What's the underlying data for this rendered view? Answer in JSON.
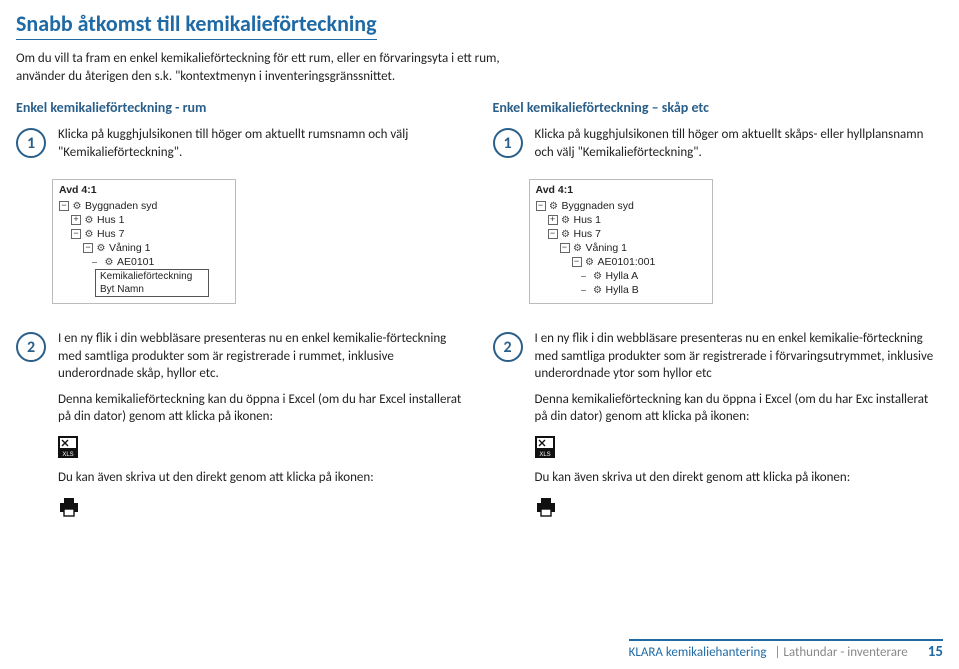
{
  "title": "Snabb åtkomst till kemikalieförteckning",
  "intro": "Om du vill ta fram en enkel kemikalieförteckning för ett rum, eller en förvaringsyta i ett rum, använder du återigen den s.k. \"kontextmenyn i inventeringsgränssnittet.",
  "left": {
    "subhead": "Enkel kemikalieförteckning - rum",
    "step1": "Klicka på kugghjulsikonen till höger om aktuellt rumsnamn och välj \"Kemikalieförteckning\".",
    "tree_title": "Avd 4:1",
    "tree": {
      "n1": "Byggnaden syd",
      "n2": "Hus 1",
      "n3": "Hus 7",
      "n4": "Våning 1",
      "n5": "AE0101"
    },
    "ctx": {
      "a": "Kemikalieförteckning",
      "b": "Byt Namn"
    },
    "step2a": "I en ny flik i din webbläsare presenteras nu en enkel kemikalie-förteckning med samtliga produkter som är registrerade i rummet, inklusive underordnade skåp, hyllor etc.",
    "step2b": "Denna kemikalieförteckning kan du öppna i Excel (om du har Excel installerat på din dator) genom att klicka på ikonen:",
    "step2c": "Du kan även skriva ut den direkt genom att klicka på ikonen:"
  },
  "right": {
    "subhead": "Enkel kemikalieförteckning – skåp etc",
    "step1": "Klicka på kugghjulsikonen till höger om aktuellt skåps- eller hyllplansnamn och välj \"Kemikalieförteckning\".",
    "tree_title": "Avd 4:1",
    "tree": {
      "n1": "Byggnaden syd",
      "n2": "Hus 1",
      "n3": "Hus 7",
      "n4": "Våning 1",
      "n5": "AE0101:001",
      "n6": "Hylla A",
      "n7": "Hylla B"
    },
    "step2a": "I en ny flik i din webbläsare presenteras nu en enkel kemikalie-förteckning med samtliga produkter som är registrerade i förvaringsutrymmet, inklusive underordnade ytor som hyllor etc",
    "step2b": "Denna kemikalieförteckning kan du öppna i Excel (om du har Exc installerat på din dator) genom att klicka på ikonen:",
    "step2c": "Du kan även skriva ut den direkt genom att klicka på ikonen:"
  },
  "badges": {
    "one": "1",
    "two": "2"
  },
  "footer": {
    "brand": "KLARA kemikaliehantering",
    "sub": "Lathundar - inventerare",
    "page": "15"
  }
}
